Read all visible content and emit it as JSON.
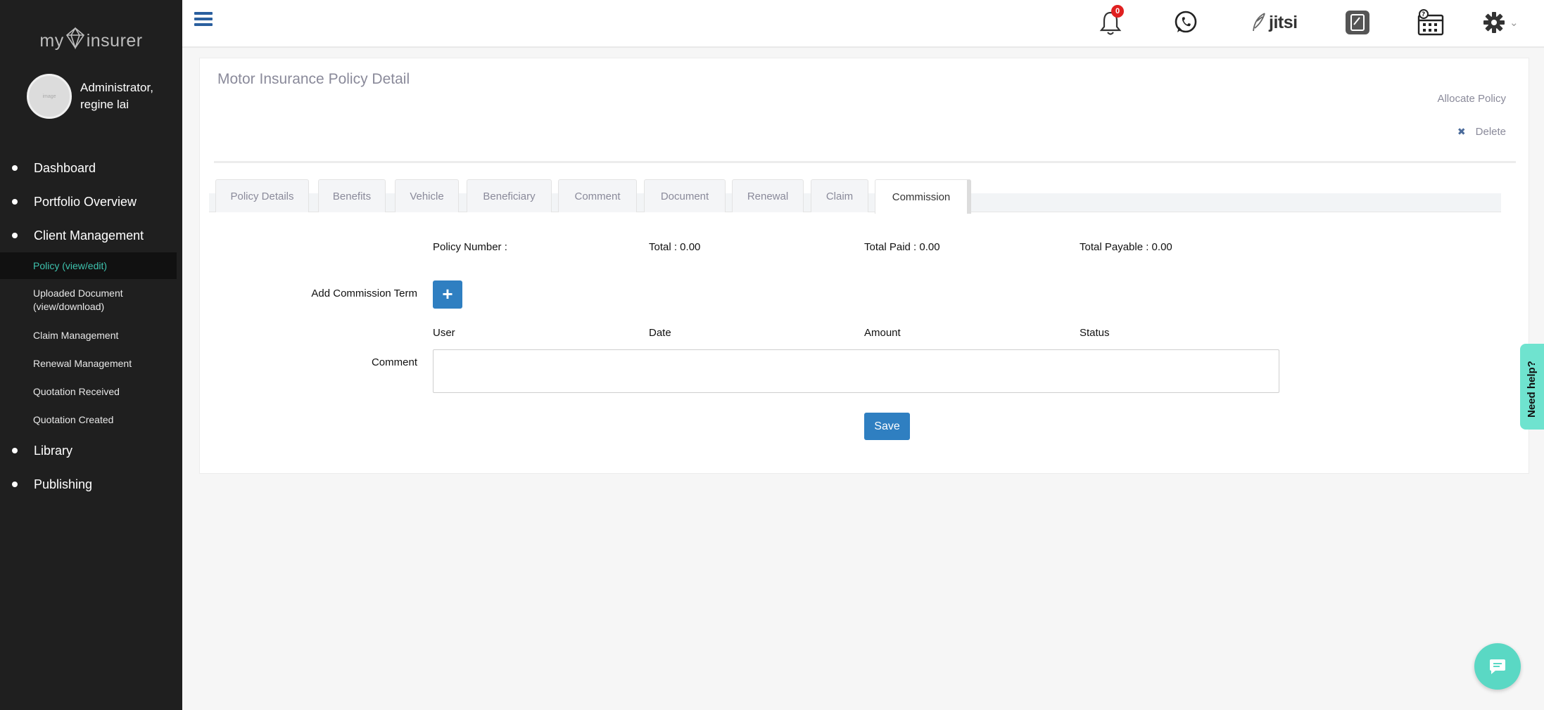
{
  "app": {
    "logo_left": "my",
    "logo_right": "insurer"
  },
  "profile": {
    "avatar_text": "image",
    "name_line1": "Administrator,",
    "name_line2": "regine lai"
  },
  "nav": {
    "dashboard": "Dashboard",
    "portfolio": "Portfolio Overview",
    "client_management": "Client Management",
    "sub_policy": "Policy (view/edit)",
    "sub_uploaded_1": "Uploaded Document",
    "sub_uploaded_2": "(view/download)",
    "sub_claim": "Claim Management",
    "sub_renewal": "Renewal Management",
    "sub_quotation_received": "Quotation Received",
    "sub_quotation_created": "Quotation Created",
    "library": "Library",
    "publishing": "Publishing"
  },
  "topbar": {
    "notification_count": "0",
    "jitsi_label": "jitsi",
    "settings_caret": "⌄"
  },
  "panel": {
    "title": "Motor Insurance Policy Detail",
    "allocate": "Allocate Policy",
    "delete": "Delete"
  },
  "tabs": {
    "policy_details": "Policy Details",
    "benefits": "Benefits",
    "vehicle": "Vehicle",
    "beneficiary": "Beneficiary",
    "comment": "Comment",
    "document": "Document",
    "renewal": "Renewal",
    "claim": "Claim",
    "commission": "Commission"
  },
  "commission": {
    "policy_number": "Policy Number :",
    "total": "Total : 0.00",
    "total_paid": "Total Paid : 0.00",
    "total_payable": "Total Payable : 0.00",
    "add_term_label": "Add Commission Term",
    "add_button": "+",
    "col_user": "User",
    "col_date": "Date",
    "col_amount": "Amount",
    "col_status": "Status",
    "comment_label": "Comment",
    "comment_value": "",
    "save": "Save"
  },
  "help": {
    "need_help": "Need help?"
  },
  "colors": {
    "sidebar": "#1f1f1f",
    "active_nav": "#3ec3ae",
    "primary_button": "#2f7fc1",
    "help_tab": "#6fe3cf"
  }
}
